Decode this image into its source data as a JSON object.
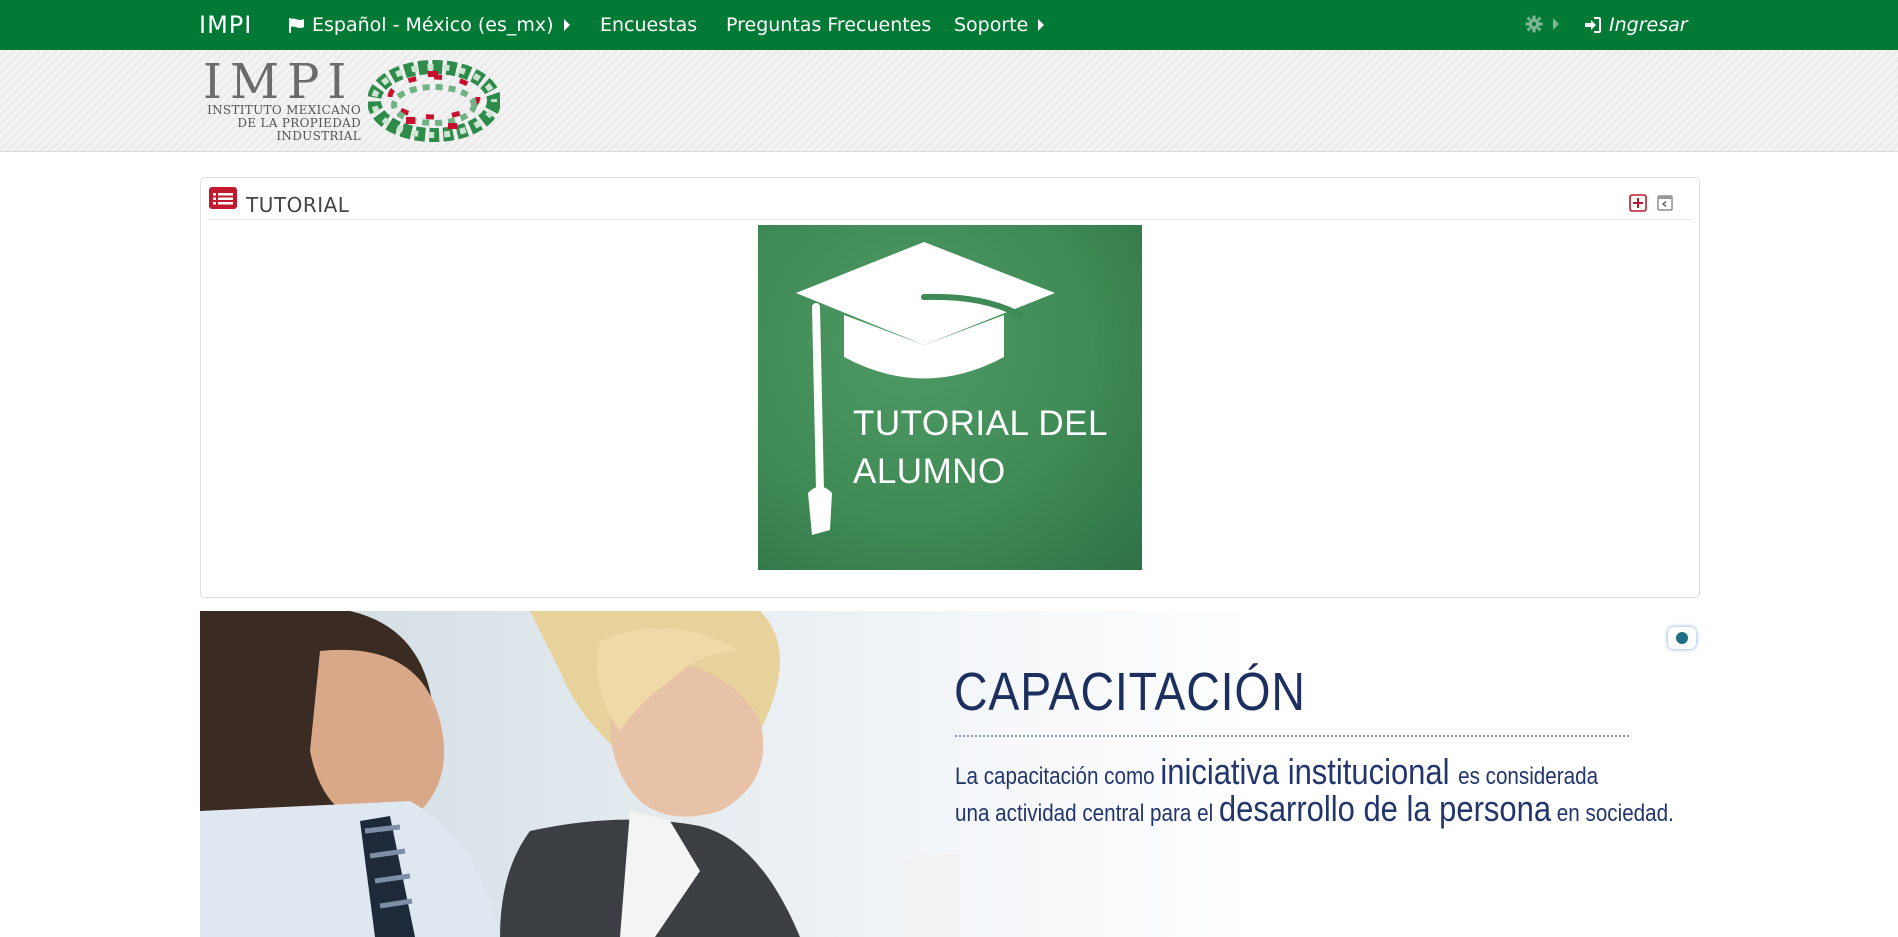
{
  "navbar": {
    "brand": "IMPI",
    "language": "Español - México (es_mx)",
    "links": [
      "Encuestas",
      "Preguntas Frecuentes"
    ],
    "support": "Soporte",
    "login": "Ingresar",
    "bg_color": "#037936"
  },
  "logo": {
    "wordmark": "IMPI",
    "subtitle_lines": [
      "INSTITUTO MEXICANO",
      "DE LA PROPIEDAD",
      "INDUSTRIAL"
    ]
  },
  "panel": {
    "title": "TUTORIAL",
    "image_text_lines": [
      "TUTORIAL DEL",
      "ALUMNO"
    ],
    "accent_color": "#c0192d"
  },
  "banner": {
    "title": "CAPACITACIÓN",
    "line1": [
      {
        "text": "La capacitación como ",
        "size": "sm"
      },
      {
        "text": "iniciativa institucional ",
        "size": "lg"
      },
      {
        "text": " es considerada",
        "size": "sm"
      }
    ],
    "line2": [
      {
        "text": "una actividad central para el ",
        "size": "sm"
      },
      {
        "text": "desarrollo de la persona",
        "size": "lg"
      },
      {
        "text": " en sociedad.",
        "size": "sm"
      }
    ],
    "text_color": "#1c2f5e"
  }
}
